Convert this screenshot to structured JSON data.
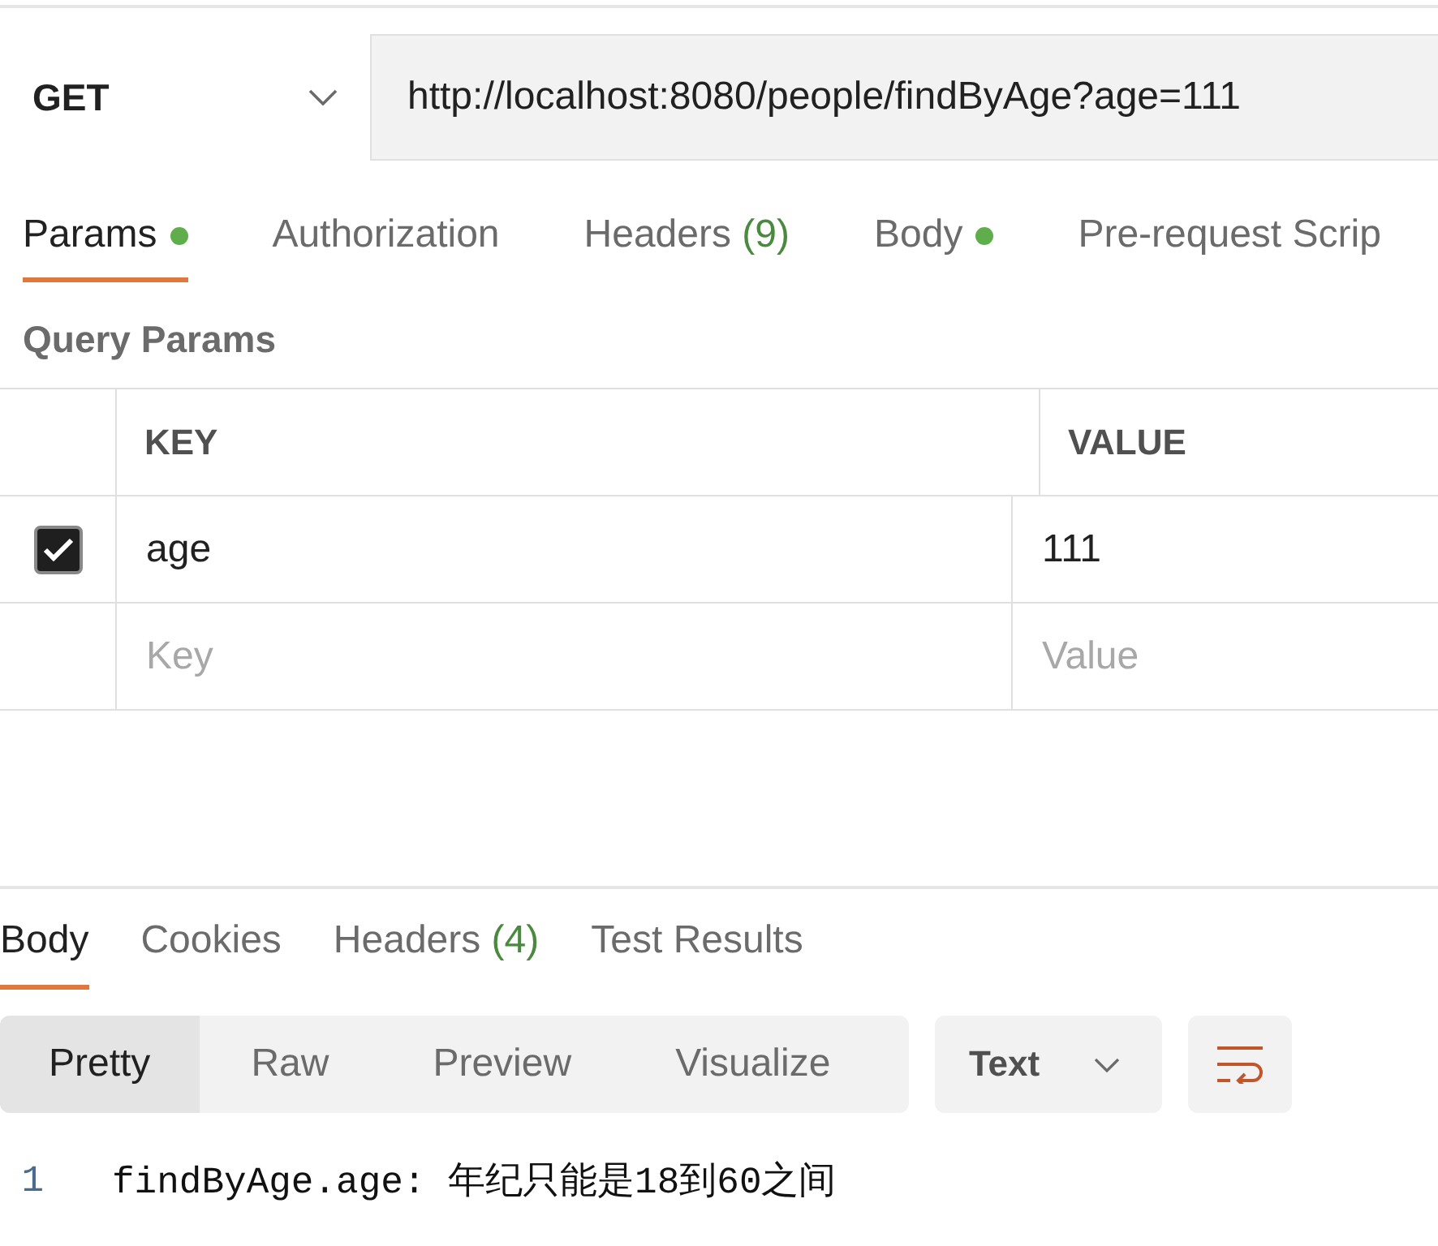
{
  "request": {
    "method": "GET",
    "url": "http://localhost:8080/people/findByAge?age=111"
  },
  "request_tabs": [
    {
      "label": "Params",
      "selected": true,
      "dot": true
    },
    {
      "label": "Authorization",
      "selected": false,
      "dot": false
    },
    {
      "label": "Headers",
      "count": "(9)",
      "selected": false,
      "dot": false
    },
    {
      "label": "Body",
      "selected": false,
      "dot": true
    },
    {
      "label": "Pre-request Scrip",
      "selected": false,
      "dot": false
    }
  ],
  "query_params": {
    "title": "Query Params",
    "columns": [
      "KEY",
      "VALUE"
    ],
    "rows": [
      {
        "checked": true,
        "key": "age",
        "value": "111"
      }
    ],
    "new_row": {
      "key_placeholder": "Key",
      "value_placeholder": "Value"
    }
  },
  "response_tabs": [
    {
      "label": "Body",
      "selected": true
    },
    {
      "label": "Cookies",
      "selected": false
    },
    {
      "label": "Headers",
      "count": "(4)",
      "selected": false
    },
    {
      "label": "Test Results",
      "selected": false
    }
  ],
  "view_modes": [
    {
      "label": "Pretty",
      "selected": true
    },
    {
      "label": "Raw",
      "selected": false
    },
    {
      "label": "Preview",
      "selected": false
    },
    {
      "label": "Visualize",
      "selected": false
    }
  ],
  "format": "Text",
  "body_lines": [
    {
      "number": "1",
      "text": "findByAge.age: 年纪只能是18到60之间"
    }
  ]
}
